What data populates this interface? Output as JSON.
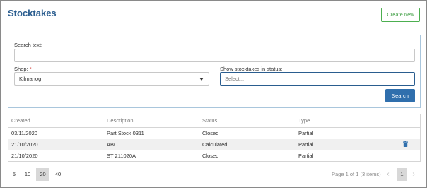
{
  "header": {
    "title": "Stocktakes",
    "create_label": "Create new"
  },
  "filters": {
    "search_label": "Search text:",
    "search_value": "",
    "shop_label": "Shop:",
    "shop_required_mark": "*",
    "shop_value": "Kilmahog",
    "status_label": "Show stocktakes in status:",
    "status_placeholder": "Select...",
    "search_button": "Search"
  },
  "table": {
    "columns": [
      "Created",
      "Description",
      "Status",
      "Type"
    ],
    "rows": [
      {
        "created": "03/11/2020",
        "description": "Part Stock 0311",
        "status": "Closed",
        "type": "Partial"
      },
      {
        "created": "21/10/2020",
        "description": "ABC",
        "status": "Calculated",
        "type": "Partial"
      },
      {
        "created": "21/10/2020",
        "description": "ST 211020A",
        "status": "Closed",
        "type": "Partial"
      }
    ]
  },
  "pagination": {
    "page_sizes": [
      "5",
      "10",
      "20",
      "40"
    ],
    "active_size": "20",
    "page_info": "Page 1 of 1 (3 items)",
    "current_page": "1",
    "prev_icon": "chevron-left-icon",
    "next_icon": "chevron-right-icon"
  },
  "colors": {
    "title": "#2a5d8f",
    "create_border": "#4caf50",
    "search_button_bg": "#2f6fad",
    "trash_icon": "#2f6fad"
  }
}
